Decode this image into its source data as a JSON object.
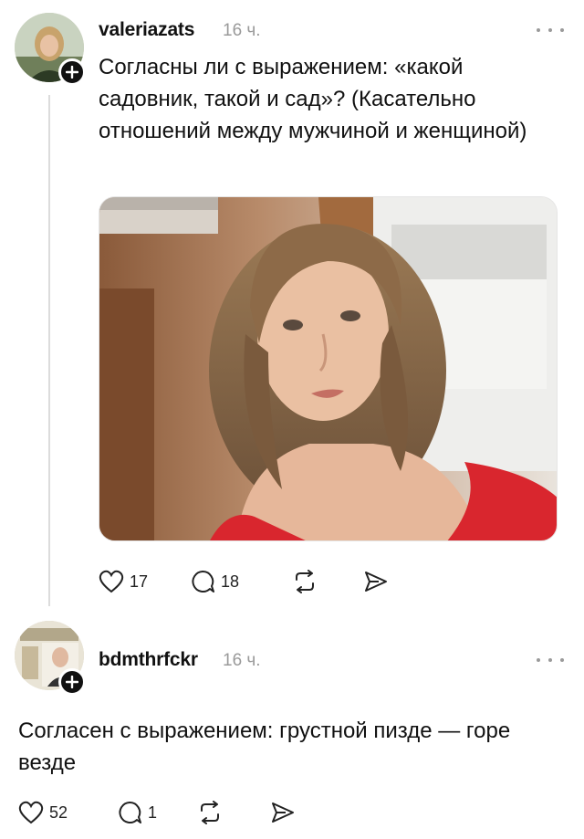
{
  "posts": [
    {
      "username": "valeriazats",
      "time": "16 ч.",
      "text": "Согласны ли с выражением: «какой садовник, такой и сад»? (Касательно отношений между мужчиной и женщиной)",
      "likes": "17",
      "replies": "18",
      "icons": [
        "heart-icon",
        "comment-icon",
        "repost-icon",
        "share-icon",
        "more-icon",
        "follow-plus-icon"
      ]
    },
    {
      "username": "bdmthrfckr",
      "time": "16 ч.",
      "text": "Согласен с выражением: грустной пизде — горе везде",
      "likes": "52",
      "replies": "1",
      "icons": [
        "heart-icon",
        "comment-icon",
        "repost-icon",
        "share-icon",
        "more-icon",
        "follow-plus-icon"
      ]
    }
  ],
  "colors": {
    "text": "#111111",
    "muted": "#9a9a9a",
    "badge": "#111111",
    "thread_line": "#dcdcdc"
  }
}
